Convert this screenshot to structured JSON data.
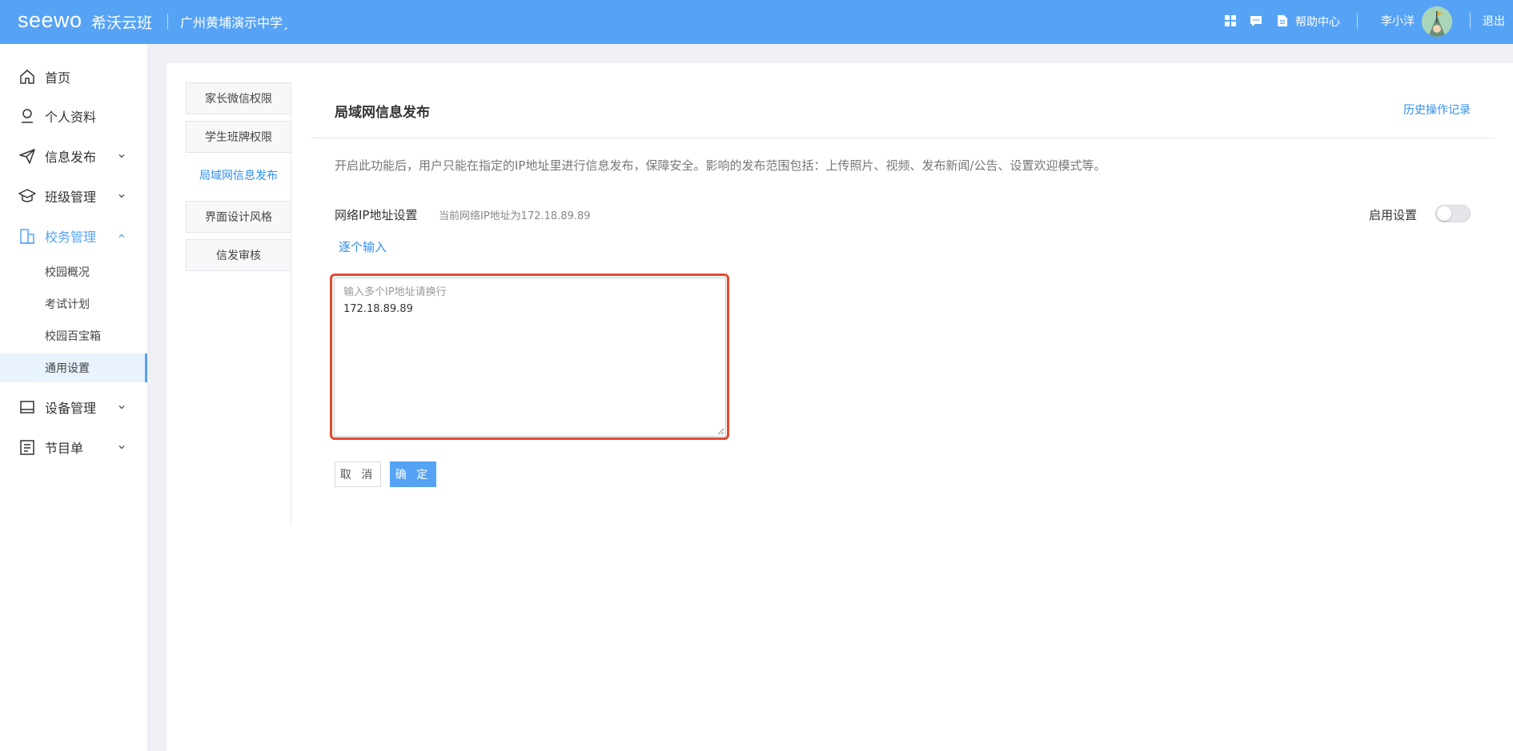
{
  "header": {
    "logo": "seewo",
    "product": "希沃云班",
    "school": "广州黄埔演示中学¸",
    "help": "帮助中心",
    "user": "李小洋",
    "logout": "退出"
  },
  "sidebar": {
    "items": [
      {
        "label": "首页",
        "icon": "home-icon"
      },
      {
        "label": "个人资料",
        "icon": "user-icon"
      },
      {
        "label": "信息发布",
        "icon": "send-icon"
      },
      {
        "label": "班级管理",
        "icon": "graduation-cap-icon"
      },
      {
        "label": "校务管理",
        "icon": "building-icon"
      },
      {
        "label": "设备管理",
        "icon": "monitor-icon"
      },
      {
        "label": "节目单",
        "icon": "document-icon"
      }
    ],
    "sub_items": [
      "校园概况",
      "考试计划",
      "校园百宝箱",
      "通用设置"
    ]
  },
  "tabs": [
    "家长微信权限",
    "学生班牌权限",
    "局域网信息发布",
    "界面设计风格",
    "信发审核"
  ],
  "panel": {
    "title": "局域网信息发布",
    "history": "历史操作记录",
    "description": "开启此功能后，用户只能在指定的IP地址里进行信息发布，保障安全。影响的发布范围包括：上传照片、视频、发布新闻/公告、设置欢迎模式等。",
    "ip_label": "网络IP地址设置",
    "ip_hint": "当前网络IP地址为172.18.89.89",
    "enable_label": "启用设置",
    "enable_on": false,
    "one_by_one": "逐个输入",
    "textarea_placeholder": "输入多个IP地址请换行",
    "textarea_value": "172.18.89.89",
    "cancel": "取 消",
    "confirm": "确 定"
  },
  "colors": {
    "header": "#56a3f5",
    "accent": "#2f8ff0",
    "highlight": "#e3492e"
  }
}
